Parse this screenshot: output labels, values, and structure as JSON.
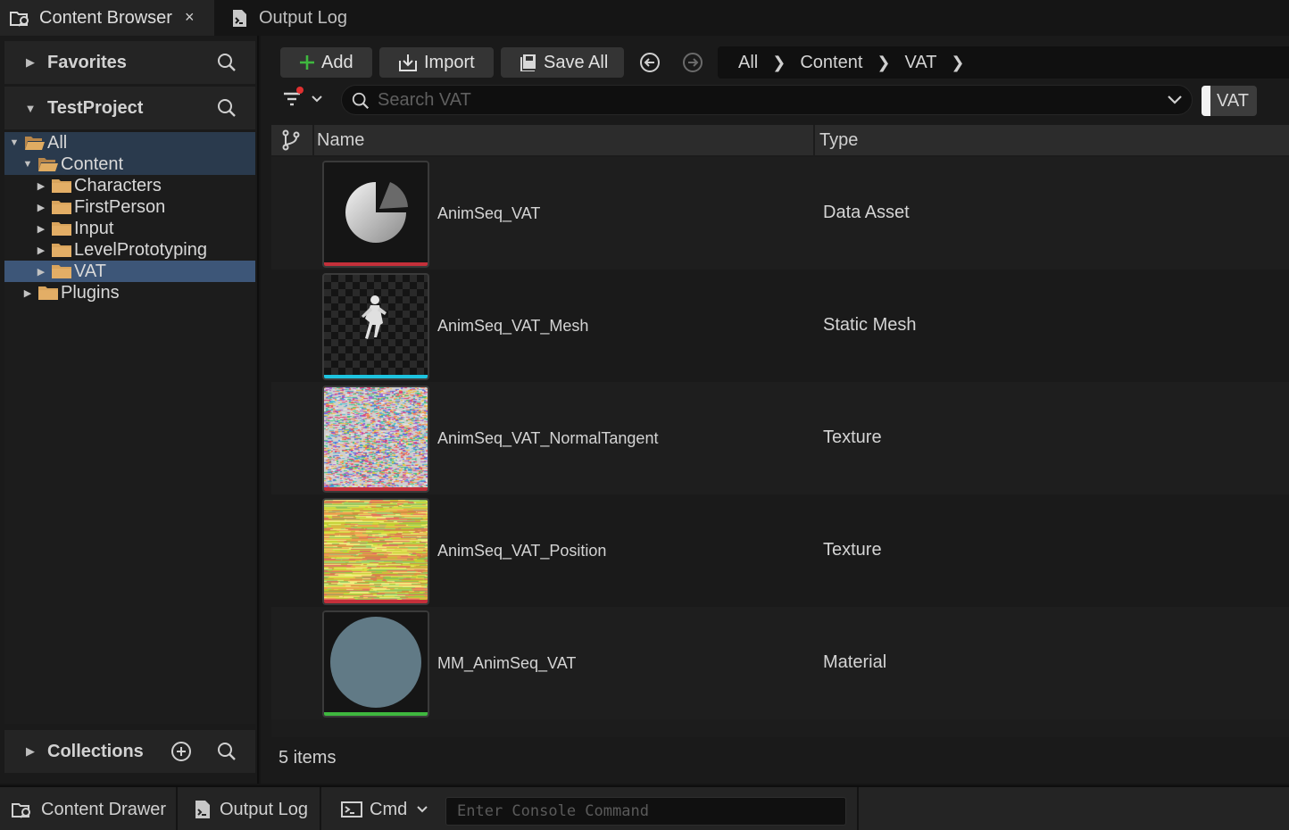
{
  "tabs": [
    {
      "label": "Content Browser",
      "icon": "content-browser-icon",
      "close": "×",
      "active": true
    },
    {
      "label": "Output Log",
      "icon": "output-log-icon",
      "active": false
    }
  ],
  "left_panel": {
    "favorites": {
      "label": "Favorites"
    },
    "project": {
      "label": "TestProject"
    },
    "collections": {
      "label": "Collections"
    },
    "tree": [
      {
        "label": "All",
        "level": 0,
        "expanded": true,
        "open_folder": true
      },
      {
        "label": "Content",
        "level": 1,
        "expanded": true,
        "open_folder": true
      },
      {
        "label": "Characters",
        "level": 2,
        "expanded": false
      },
      {
        "label": "FirstPerson",
        "level": 2,
        "expanded": false
      },
      {
        "label": "Input",
        "level": 2,
        "expanded": false
      },
      {
        "label": "LevelPrototyping",
        "level": 2,
        "expanded": false
      },
      {
        "label": "VAT",
        "level": 2,
        "expanded": false,
        "selected": true
      },
      {
        "label": "Plugins",
        "level": 1,
        "expanded": false
      }
    ]
  },
  "toolbar": {
    "add_label": "Add",
    "import_label": "Import",
    "save_all_label": "Save All",
    "breadcrumb": [
      "All",
      "Content",
      "VAT"
    ]
  },
  "search": {
    "placeholder": "Search VAT",
    "value": ""
  },
  "filter_chip": {
    "label": "VAT"
  },
  "columns": {
    "name": "Name",
    "type": "Type"
  },
  "assets": [
    {
      "name": "AnimSeq_VAT",
      "type": "Data Asset",
      "thumb": "data-asset",
      "strip_color": "#c4303a"
    },
    {
      "name": "AnimSeq_VAT_Mesh",
      "type": "Static Mesh",
      "thumb": "static-mesh",
      "strip_color": "#1ec4e0"
    },
    {
      "name": "AnimSeq_VAT_NormalTangent",
      "type": "Texture",
      "thumb": "texture-noise",
      "strip_color": "#c4303a"
    },
    {
      "name": "AnimSeq_VAT_Position",
      "type": "Texture",
      "thumb": "texture-position",
      "strip_color": "#c4303a"
    },
    {
      "name": "MM_AnimSeq_VAT",
      "type": "Material",
      "thumb": "material-sphere",
      "strip_color": "#3fb83f"
    }
  ],
  "status": {
    "item_count": "5 items"
  },
  "bottom_bar": {
    "drawer_label": "Content Drawer",
    "output_log_label": "Output Log",
    "cmd_label": "Cmd",
    "console_placeholder": "Enter Console Command"
  },
  "colors": {
    "selection": "#3d5678",
    "folder": "#d9a45c",
    "accent_green": "#3fb83f"
  }
}
